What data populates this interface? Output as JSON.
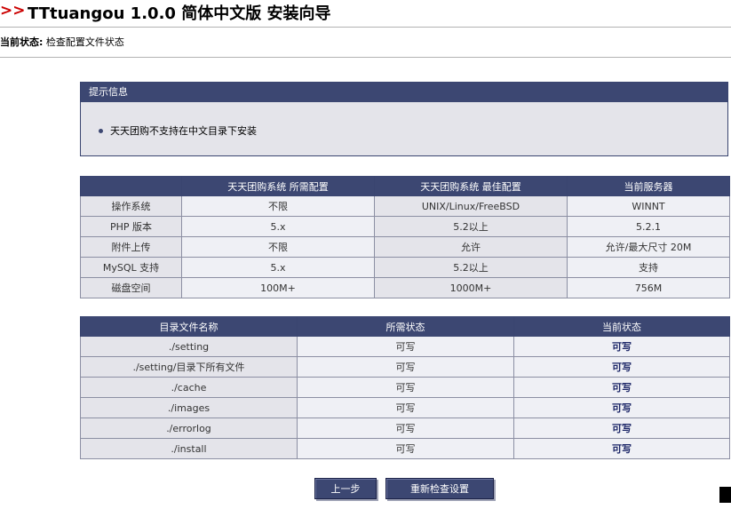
{
  "header": {
    "arrows": ">>",
    "title": "TTtuangou 1.0.0 简体中文版 安装向导"
  },
  "status": {
    "label": "当前状态:",
    "value": "检查配置文件状态"
  },
  "notice": {
    "title": "提示信息",
    "message": "天天团购不支持在中文目录下安装"
  },
  "env_table": {
    "headers": [
      "",
      "天天团购系统 所需配置",
      "天天团购系统 最佳配置",
      "当前服务器"
    ],
    "rows": [
      [
        "操作系统",
        "不限",
        "UNIX/Linux/FreeBSD",
        "WINNT"
      ],
      [
        "PHP 版本",
        "5.x",
        "5.2以上",
        "5.2.1"
      ],
      [
        "附件上传",
        "不限",
        "允许",
        "允许/最大尺寸 20M"
      ],
      [
        "MySQL 支持",
        "5.x",
        "5.2以上",
        "支持"
      ],
      [
        "磁盘空间",
        "100M+",
        "1000M+",
        "756M"
      ]
    ]
  },
  "dir_table": {
    "headers": [
      "目录文件名称",
      "所需状态",
      "当前状态"
    ],
    "rows": [
      [
        "./setting",
        "可写",
        "可写"
      ],
      [
        "./setting/目录下所有文件",
        "可写",
        "可写"
      ],
      [
        "./cache",
        "可写",
        "可写"
      ],
      [
        "./images",
        "可写",
        "可写"
      ],
      [
        "./errorlog",
        "可写",
        "可写"
      ],
      [
        "./install",
        "可写",
        "可写"
      ]
    ]
  },
  "buttons": {
    "prev": "上一步",
    "recheck": "重新检查设置"
  },
  "colors": {
    "header_bg": "#3c4772",
    "row_dark": "#e4e4ea",
    "row_light": "#eff0f5",
    "title_arrows": "#cc0000"
  }
}
